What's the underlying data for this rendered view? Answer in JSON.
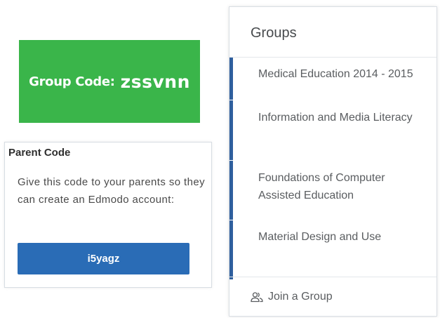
{
  "group_code": {
    "label": "Group Code:",
    "value": "zssvnn",
    "color": "#3ab54a"
  },
  "parent_code": {
    "title": "Parent Code",
    "description": "Give this code to your parents so they can create an Edmodo account:",
    "code": "i5yagz",
    "button_color": "#2a6cb6"
  },
  "groups": {
    "title": "Groups",
    "items": [
      {
        "label": "Medical Education 2014 - 2015"
      },
      {
        "label": "Information and Media Literacy"
      },
      {
        "label": "Foundations of Computer Assisted Education"
      },
      {
        "label": "Material Design and Use"
      }
    ],
    "join_label": "Join a Group",
    "join_icon": "users-icon",
    "accent_color": "#2f5f9e"
  }
}
